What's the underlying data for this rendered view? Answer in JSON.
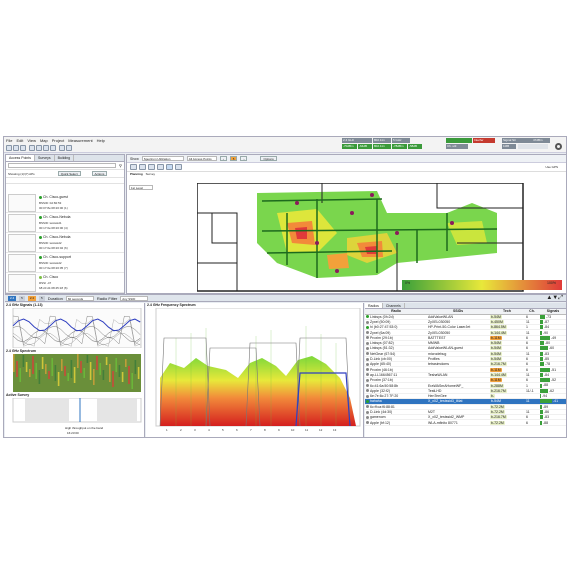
{
  "menu": [
    "File",
    "Edit",
    "View",
    "Map",
    "Project",
    "Measurement",
    "Help"
  ],
  "status": {
    "cells": [
      {
        "text": "2.4 GHz",
        "color": "#7f8a96"
      },
      {
        "text": "802.11n",
        "color": "#7f8a96"
      },
      {
        "text": "5 GHz",
        "color": "#7f8a96"
      },
      {
        "text": "-70dBm",
        "color": "#3a9a3a"
      },
      {
        "text": "-64dB",
        "color": "#3a9a3a"
      },
      {
        "text": "802.11n",
        "color": "#3a9a3a"
      },
      {
        "text": "-78dBm",
        "color": "#3a9a3a"
      },
      {
        "text": "-58dB",
        "color": "#3a9a3a"
      },
      {
        "text": "Interfer",
        "color": "#c53a2e"
      },
      {
        "text": "Ch. util",
        "color": "#7f8a96"
      },
      {
        "text": "Signal Str",
        "color": "#7f8a96"
      },
      {
        "text": "1MB",
        "color": "#7f8a96"
      },
      {
        "text": "47dBm",
        "color": "#7f8a96"
      }
    ]
  },
  "left": {
    "tabs": [
      "Access Points",
      "Surveys",
      "Building"
    ],
    "search_placeholder": "Search",
    "showing": "Showing (1)/(7) APs",
    "quick_select": "Quick Select",
    "actions": "Actions",
    "aps": [
      {
        "name": "Ch. Cisco-guest",
        "sub": "BSSID: 0d:82:53",
        "sub2": "00:07:8e:08:20:00 (1)",
        "color": "#2aa02a"
      },
      {
        "name": "Ch. Cisco-Nebula",
        "sub": "BSSID: testssid1",
        "sub2": "00:17:0e:08:20:00 (4)",
        "color": "#2aa02a"
      },
      {
        "name": "Ch. Cisco-Nebula",
        "sub": "BSSID: testssid2",
        "sub2": "00:17:0e:08:20:02 (6)",
        "color": "#2aa02a"
      },
      {
        "name": "Ch. Cisco-support",
        "sub": "BSSID: testssid2",
        "sub2": "00:17:0e:08:20:05 (7)",
        "color": "#2aa02a"
      },
      {
        "name": "Ch. Cisco",
        "sub": "RSSI -47",
        "sub2": "b8:c0:d1:08:45:18 (6)",
        "color": "#7cbf44"
      }
    ]
  },
  "map": {
    "show_label": "Show",
    "show_value": "Spectrum Utilization",
    "ap_points_label": "All Access Points",
    "options_label": "Options",
    "use_gps": "Use GPS",
    "tabs": [
      "Planning",
      "Survey"
    ],
    "floor": "1st Level",
    "legend_low": "0%",
    "legend_high": "100%"
  },
  "midbar": {
    "labels": [
      "2.4",
      "5",
      "2.4",
      "5"
    ],
    "duration_label": "Duration",
    "duration_value": "60 seconds",
    "filter_label": "Radio Filter",
    "filter_value": "Any SSID"
  },
  "panels": {
    "signals_title": "2.4 GHz Signals (1-13)",
    "spectrum_title": "2.4 GHz Spectrum",
    "survey_title": "Active Survey",
    "freq_title": "2.4 GHz Frequency Spectrum",
    "survey_time": "16:23:00",
    "survey_note": "High throughput on the band"
  },
  "table": {
    "tabs": [
      "Radios",
      "Channels"
    ],
    "headers": [
      "Radio",
      "SSIDs",
      "Tech",
      "Ch.",
      "Signals"
    ],
    "rows": [
      {
        "radio": "Linksys (0h:2d)",
        "ssid": "AddValueWLAN",
        "tech": "b-54M",
        "ch": "6",
        "sig": "-73",
        "c": "#2aa02a",
        "tc": "#e8f0c8"
      },
      {
        "radio": "Zyxel (50:09)",
        "ssid": "ZyXEL030050",
        "tech": "b-450M",
        "ch": "11",
        "sig": "-87",
        "c": "#888",
        "tc": "#e8f0c8"
      },
      {
        "radio": "hi (b0:27:47:53:0)",
        "ssid": "HP-Print-50-Color LaserJet",
        "tech": "b-864.5M",
        "ch": "1",
        "sig": "-84",
        "c": "#2aa02a",
        "tc": "#e8f0c8"
      },
      {
        "radio": "Zyxel (6a:09)",
        "ssid": "ZyXEL030050",
        "tech": "b-144.4M",
        "ch": "11",
        "sig": "-90",
        "c": "#888",
        "tc": "#e8f0c8"
      },
      {
        "radio": "Proxim (29:1b)",
        "ssid": "BATTTEST",
        "tech": "b-11M",
        "ch": "6",
        "sig": "-49",
        "c": "#888",
        "tc": "#f2a13a"
      },
      {
        "radio": "Linksys (07:82)",
        "ssid": "MMWB",
        "tech": "b-54M",
        "ch": "6",
        "sig": "-80",
        "c": "#888",
        "tc": "#e8f0c8"
      },
      {
        "radio": "Linksys (51:32)",
        "ssid": "AddValueWLAN-guest",
        "tech": "b-54M",
        "ch": "6",
        "sig": "-60",
        "c": "#888",
        "tc": "#e8f0c8"
      },
      {
        "radio": "NetGear (67:54)",
        "ssid": "microdebug",
        "tech": "b-54M",
        "ch": "11",
        "sig": "-83",
        "c": "#888",
        "tc": "#e8f0c8"
      },
      {
        "radio": "D-Link (cb:00)",
        "ssid": "Profiles",
        "tech": "b-54M",
        "ch": "6",
        "sig": "-85",
        "c": "#888",
        "tc": "#e8f0c8"
      },
      {
        "radio": "Apple (65:40)",
        "ssid": "tetrasimdoms",
        "tech": "b-216.7M",
        "ch": "6",
        "sig": "-78",
        "c": "#888",
        "tc": "#e8f0c8"
      },
      {
        "radio": "Proxim (46:1b)",
        "ssid": "",
        "tech": "b-11M",
        "ch": "6",
        "sig": "-51",
        "c": "#888",
        "tc": "#f2a13a"
      },
      {
        "radio": "ap-LL1664567:11",
        "ssid": "TeshaWLAN",
        "tech": "b-144.4M",
        "ch": "11",
        "sig": "-84",
        "c": "#888",
        "tc": "#e8f0c8"
      },
      {
        "radio": "Proxim (37:1b)",
        "ssid": "",
        "tech": "b-11M",
        "ch": "6",
        "sig": "-52",
        "c": "#888",
        "tc": "#f2a13a"
      },
      {
        "radio": "6c:41:6a:50:58:8b",
        "ssid": "EraWASmAHomeWF_",
        "tech": "b-288M",
        "ch": "1",
        "sig": "-88",
        "c": "#888",
        "tc": "#e8f0c8"
      },
      {
        "radio": "Apple (32:f2)",
        "ssid": "TestLHD",
        "tech": "b-216.7M",
        "ch": "11/-1",
        "sig": "-62",
        "c": "#888",
        "tc": "#e8f0c8"
      },
      {
        "radio": "6e:7e:6c:27:7F:20",
        "ssid": "HenTeeGee",
        "tech": "b-",
        "ch": "",
        "sig": "-94",
        "c": "#888",
        "tc": "#e8f0c8"
      },
      {
        "radio": "hahaha",
        "ssid": "X_x0Z_testssid3_iMat",
        "tech": "b-54M",
        "ch": "11",
        "sig": "-41",
        "c": "#2aa02a",
        "tc": "#e8f0c8",
        "sel": true
      },
      {
        "radio": "6c:ff:ca:f6:88:81",
        "ssid": "",
        "tech": "b-72.2M",
        "ch": "",
        "sig": "-89",
        "c": "#888",
        "tc": "#e8f0c8"
      },
      {
        "radio": "D-Link (4d:30)",
        "ssid": "M2T",
        "tech": "b-72.2M",
        "ch": "11",
        "sig": "-86",
        "c": "#888",
        "tc": "#e8f0c8"
      },
      {
        "radio": "gamenom",
        "ssid": "X_x0Z_testssid2_WMP",
        "tech": "b-216.7M",
        "ch": "6",
        "sig": "-83",
        "c": "#888",
        "tc": "#e8f0c8"
      },
      {
        "radio": "Apple (bf:12)",
        "ssid": "WLA-mfinito 80771",
        "tech": "b-72.2M",
        "ch": "6",
        "sig": "-88",
        "c": "#888",
        "tc": "#e8f0c8"
      }
    ]
  }
}
